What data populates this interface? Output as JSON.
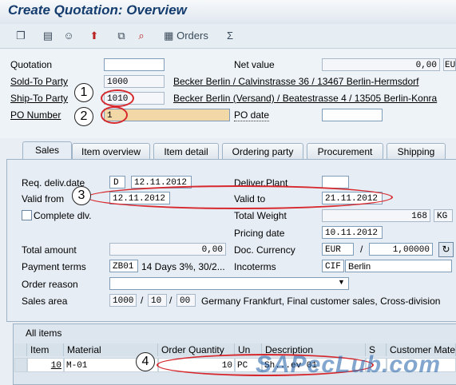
{
  "title": "Create Quotation: Overview",
  "toolbar": {
    "orders_label": "Orders"
  },
  "header": {
    "quotation": {
      "label": "Quotation",
      "value": ""
    },
    "net_value": {
      "label": "Net value",
      "value": "0,00",
      "currency": "EU"
    },
    "sold_to": {
      "label": "Sold-To Party",
      "value": "1000",
      "text": "Becker Berlin / Calvinstrasse 36 / 13467 Berlin-Hermsdorf"
    },
    "ship_to": {
      "label": "Ship-To Party",
      "value": "1010",
      "text": "Becker Berlin (Versand) / Beatestrasse 4 / 13505 Berlin-Konra"
    },
    "po_number": {
      "label": "PO Number",
      "value": "1"
    },
    "po_date": {
      "label": "PO date",
      "value": ""
    }
  },
  "tabs": [
    "Sales",
    "Item overview",
    "Item detail",
    "Ordering party",
    "Procurement",
    "Shipping"
  ],
  "sales": {
    "req_deliv": {
      "label": "Req. deliv.date",
      "type": "D",
      "value": "12.11.2012"
    },
    "deliver_plant": {
      "label": "Deliver.Plant",
      "value": ""
    },
    "valid_from": {
      "label": "Valid from",
      "value": "12.11.2012"
    },
    "valid_to": {
      "label": "Valid to",
      "value": "21.11.2012"
    },
    "complete_dlv": {
      "label": "Complete dlv."
    },
    "total_weight": {
      "label": "Total Weight",
      "value": "168",
      "unit": "KG"
    },
    "pricing_date": {
      "label": "Pricing date",
      "value": "10.11.2012"
    },
    "total_amount": {
      "label": "Total amount",
      "value": "0,00"
    },
    "doc_currency": {
      "label": "Doc. Currency",
      "value": "EUR",
      "sep": "/",
      "rate": "1,00000"
    },
    "payment_terms": {
      "label": "Payment terms",
      "value": "ZB01",
      "text": "14 Days 3%, 30/2..."
    },
    "incoterms": {
      "label": "Incoterms",
      "value": "CIF",
      "text": "Berlin"
    },
    "order_reason": {
      "label": "Order reason",
      "value": ""
    },
    "sales_area": {
      "label": "Sales area",
      "org": "1000",
      "channel": "10",
      "division": "00",
      "sep": "/",
      "text": "Germany Frankfurt, Final customer sales, Cross-division"
    }
  },
  "items": {
    "title": "All items",
    "columns": [
      "Item",
      "Material",
      "Order Quantity",
      "Un",
      "Description",
      "S",
      "Customer Mate"
    ],
    "rows": [
      {
        "item": "10",
        "material": "M-01",
        "qty": "10",
        "un": "PC",
        "desc": "Sh...ev 01"
      }
    ]
  },
  "callouts": [
    "1",
    "2",
    "3",
    "4"
  ],
  "watermark": "SAPecLub.com",
  "colors": {
    "title": "#143c6e",
    "highlight": "#d6282d",
    "required": "#f2d8a7"
  }
}
